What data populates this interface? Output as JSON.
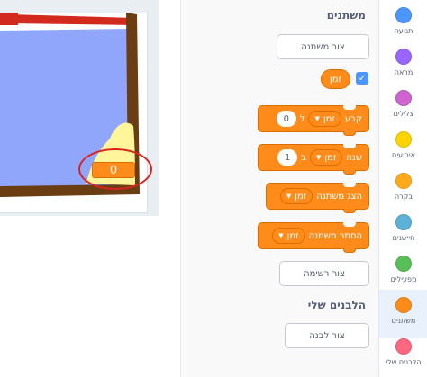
{
  "stage": {
    "monitor_value": "0"
  },
  "palette": {
    "variables_title": "משתנים",
    "make_variable_button": "צור משתנה",
    "variable_reporter": "זמן",
    "variable_checked": true,
    "set_block": {
      "text": "קבע",
      "variable": "זמן",
      "to": "ל",
      "value": "0"
    },
    "change_block": {
      "text": "שנה",
      "variable": "זמן",
      "by": "ב",
      "value": "1"
    },
    "show_block": {
      "text": "הצג משתנה",
      "variable": "זמן"
    },
    "hide_block": {
      "text": "הסתר משתנה",
      "variable": "זמן"
    },
    "make_list_button": "צור רשימה",
    "my_blocks_title": "הלבנים שלי",
    "make_block_button": "צור לבנה"
  },
  "categories": [
    {
      "label": "תנועה",
      "color": "#4c97ff"
    },
    {
      "label": "מראה",
      "color": "#9966ff"
    },
    {
      "label": "צלילים",
      "color": "#cf63cf"
    },
    {
      "label": "אירועים",
      "color": "#ffd500"
    },
    {
      "label": "בקרה",
      "color": "#ffab19"
    },
    {
      "label": "חיישנים",
      "color": "#5cb1d6"
    },
    {
      "label": "מפעילים",
      "color": "#59c059"
    },
    {
      "label": "משתנים",
      "color": "#ff8c1a",
      "active": true
    },
    {
      "label": "הלבנים שלי",
      "color": "#ff6680"
    }
  ]
}
